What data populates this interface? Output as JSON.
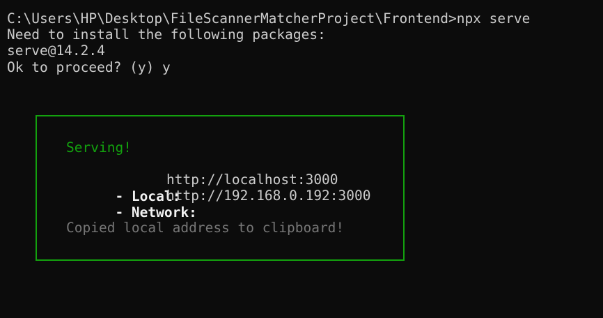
{
  "terminal": {
    "lines": [
      "C:\\Users\\HP\\Desktop\\FileScannerMatcherProject\\Frontend>npx serve",
      "Need to install the following packages:",
      "serve@14.2.4",
      "Ok to proceed? (y) y"
    ]
  },
  "serve_box": {
    "status": "Serving!",
    "local_label": "- Local:",
    "local_url": "http://localhost:3000",
    "network_label": "- Network:",
    "network_url": "http://192.168.0.192:3000",
    "clipboard_message": "Copied local address to clipboard!"
  },
  "colors": {
    "background": "#0c0c0c",
    "foreground": "#cccccc",
    "accent_green": "#13a10e",
    "muted_gray": "#767676"
  }
}
